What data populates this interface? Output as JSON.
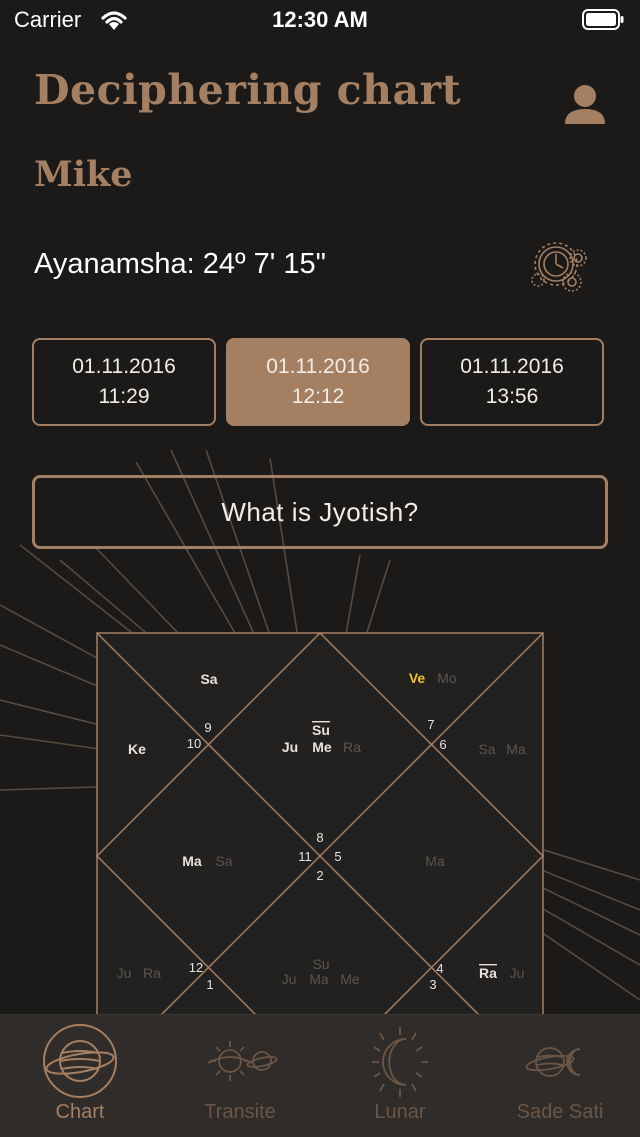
{
  "status_bar": {
    "carrier": "Carrier",
    "time": "12:30 AM"
  },
  "header": {
    "title": "Deciphering chart",
    "user_icon": "user-icon"
  },
  "profile": {
    "name": "Mike"
  },
  "ayanamsha": {
    "text": "Ayanamsha: 24º 7' 15\"",
    "button_icon": "clock-gears-icon"
  },
  "dates": [
    {
      "date": "01.11.2016",
      "time": "11:29",
      "selected": false
    },
    {
      "date": "01.11.2016",
      "time": "12:12",
      "selected": true
    },
    {
      "date": "01.11.2016",
      "time": "13:56",
      "selected": false
    }
  ],
  "jyotish_button": "What is Jyotish?",
  "chart": {
    "house_numbers": [
      "9",
      "10",
      "7",
      "6",
      "8",
      "11",
      "5",
      "2",
      "12",
      "1",
      "4",
      "3"
    ],
    "planets": {
      "h9_sa": "Sa",
      "h7_ve": "Ve",
      "h7_mo": "Mo",
      "h10_ke": "Ke",
      "h8_su": "Su",
      "h8_ju": "Ju",
      "h8_me": "Me",
      "h8_ra": "Ra",
      "h6_sa": "Sa",
      "h6_ma": "Ma",
      "h11_ma": "Ma",
      "h11_sa": "Sa",
      "h5_ma": "Ma",
      "h12_ju": "Ju",
      "h12_ra": "Ra",
      "h2_su": "Su",
      "h2_ju": "Ju",
      "h2_ma": "Ma",
      "h2_me": "Me",
      "h4_ra": "Ra",
      "h4_ju": "Ju"
    },
    "colors": {
      "line": "#a47f62",
      "bright": "#e8e1da",
      "dim": "#5b5550",
      "highlight": "#f2c230"
    }
  },
  "tabs": [
    {
      "label": "Chart",
      "icon": "saturn-chart-icon",
      "active": true
    },
    {
      "label": "Transite",
      "icon": "sun-planet-transit-icon",
      "active": false
    },
    {
      "label": "Lunar",
      "icon": "moon-rays-icon",
      "active": false
    },
    {
      "label": "Sade Sati",
      "icon": "saturn-moon-icon",
      "active": false
    }
  ]
}
